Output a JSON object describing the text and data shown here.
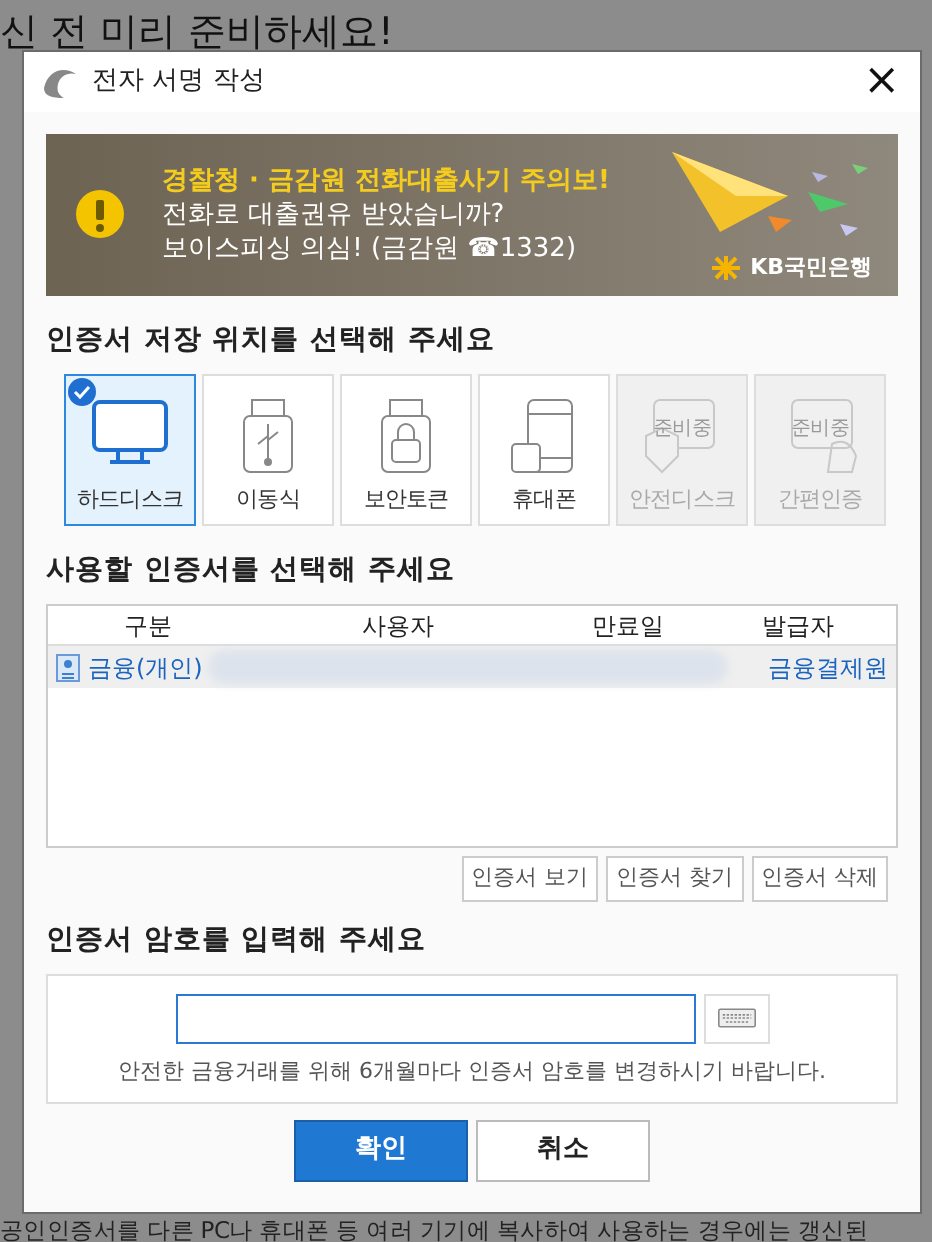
{
  "background_page": {
    "heading": "신 전 미리 준비하세요!",
    "footer_text": "공인인증서를 다른 PC나 휴대폰 등 여러 기기에 복사하여 사용하는 경우에는 갱신된"
  },
  "window": {
    "title": "전자 서명 작성",
    "close": "×"
  },
  "banner": {
    "headline": "경찰청 · 금감원 전화대출사기 주의보!",
    "lines": [
      "전화로 대출권유 받았습니까?",
      "보이스피싱 의심! (금감원 ☎1332)"
    ],
    "bank": "KB국민은행"
  },
  "storage": {
    "heading": "인증서 저장 위치를 선택해 주세요",
    "options": [
      {
        "label": "하드디스크",
        "kind": "monitor",
        "selected": true,
        "disabled": false
      },
      {
        "label": "이동식",
        "kind": "usb",
        "selected": false,
        "disabled": false
      },
      {
        "label": "보안토큰",
        "kind": "token",
        "selected": false,
        "disabled": false
      },
      {
        "label": "휴대폰",
        "kind": "phone",
        "selected": false,
        "disabled": false
      },
      {
        "label": "안전디스크",
        "kind": "safedisk",
        "selected": false,
        "disabled": true,
        "badge": "준비중"
      },
      {
        "label": "간편인증",
        "kind": "simple",
        "selected": false,
        "disabled": true,
        "badge": "준비중"
      }
    ]
  },
  "certificates": {
    "heading": "사용할 인증서를 선택해 주세요",
    "columns": [
      "구분",
      "사용자",
      "만료일",
      "발급자"
    ],
    "rows": [
      {
        "type": "금융(개인)",
        "issuer": "금융결제원",
        "selected": true
      }
    ],
    "buttons": [
      "인증서 보기",
      "인증서 찾기",
      "인증서 삭제"
    ]
  },
  "password": {
    "heading": "인증서 암호를 입력해 주세요",
    "hint": "안전한 금융거래를 위해 6개월마다 인증서 암호를 변경하시기 바랍니다."
  },
  "buttons": [
    {
      "label": "확인",
      "kind": "primary"
    },
    {
      "label": "취소",
      "kind": "secondary"
    }
  ]
}
